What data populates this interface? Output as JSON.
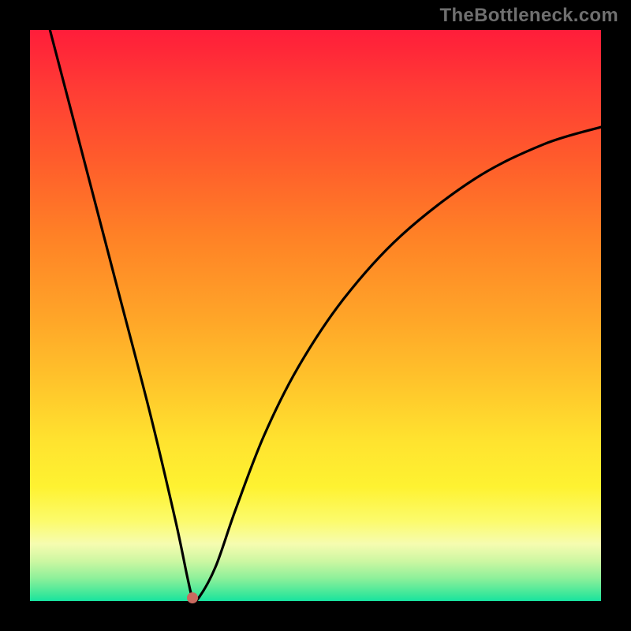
{
  "watermark": "TheBottleneck.com",
  "chart_data": {
    "type": "line",
    "title": "",
    "xlabel": "",
    "ylabel": "",
    "xlim": [
      0,
      1
    ],
    "ylim": [
      0,
      1
    ],
    "grid": false,
    "legend": false,
    "series": [
      {
        "name": "curve",
        "x": [
          0.035,
          0.09,
          0.15,
          0.21,
          0.255,
          0.276,
          0.285,
          0.295,
          0.325,
          0.36,
          0.41,
          0.47,
          0.55,
          0.65,
          0.78,
          0.9,
          1.0
        ],
        "y": [
          1.0,
          0.79,
          0.56,
          0.33,
          0.14,
          0.04,
          0.005,
          0.005,
          0.06,
          0.16,
          0.29,
          0.41,
          0.53,
          0.64,
          0.74,
          0.8,
          0.83
        ]
      }
    ],
    "marker": {
      "x": 0.285,
      "y": 0.005
    },
    "gradient_stops": [
      {
        "pos": 0.0,
        "color": "#ff1d3a"
      },
      {
        "pos": 0.5,
        "color": "#ffa428"
      },
      {
        "pos": 0.8,
        "color": "#fef231"
      },
      {
        "pos": 1.0,
        "color": "#17e3a0"
      }
    ]
  }
}
